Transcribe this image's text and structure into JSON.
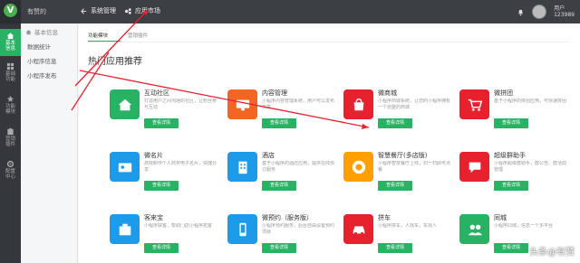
{
  "topbar": {
    "brand": "有赞的",
    "menu_system": "系统管理",
    "menu_market": "应用市场",
    "user": "用户\n123989"
  },
  "rail": [
    {
      "label": "基本\n信息",
      "icon": "home-icon",
      "active": true
    },
    {
      "label": "基础\n功能",
      "icon": "grid-icon",
      "active": false
    },
    {
      "label": "功能\n模块",
      "icon": "star-icon",
      "active": false
    },
    {
      "label": "营销\n插件",
      "icon": "puzzle-icon",
      "active": false
    },
    {
      "label": "配置\n中心",
      "icon": "gear-icon",
      "active": false
    }
  ],
  "subside": {
    "head": "基本信息",
    "items": [
      "数据统计",
      "小程序信息",
      "小程序发布"
    ]
  },
  "main": {
    "tabs": [
      "功能模块",
      "营销插件"
    ],
    "section_title": "热门应用推荐",
    "cards": [
      {
        "title": "互动社区",
        "desc": "打造用户之间沟通的社区，让粉丝参与互动",
        "btn": "查看详情",
        "color": "#27b264",
        "icon": "home-icon"
      },
      {
        "title": "内容管理",
        "desc": "小程序内容管理系统，用户可以发布文章",
        "btn": "查看详情",
        "color": "#f26522",
        "icon": "monitor-icon"
      },
      {
        "title": "微商城",
        "desc": "小程序商城系统，让您的小程序拥有一个完整的商城",
        "btn": "查看详情",
        "color": "#e8212e",
        "icon": "bag-icon"
      },
      {
        "title": "微拼团",
        "desc": "基于小程序的拼团应用，可快速拼团",
        "btn": "查看详情",
        "color": "#e8212e",
        "icon": "cart-icon"
      },
      {
        "title": "微名片",
        "desc": "高效制作个人商务电子名片，快捷分享",
        "btn": "查看详情",
        "color": "#1e9be8",
        "icon": "card-icon"
      },
      {
        "title": "酒店",
        "desc": "基于小程序的酒店应用，提供在线预订服务",
        "btn": "查看详情",
        "color": "#1e9be8",
        "icon": "building-icon"
      },
      {
        "title": "智慧餐厅(多店版)",
        "desc": "小程序智慧餐厅上线，扫一扫即可点餐",
        "btn": "查看详情",
        "color": "#ffa000",
        "icon": "coffee-icon"
      },
      {
        "title": "超级群助手",
        "desc": "小程序超级群助手，群公告、群活动管理",
        "btn": "查看详情",
        "color": "#e8212e",
        "icon": "chat-icon"
      },
      {
        "title": "客来宝",
        "desc": "小程序获客，帮助门店小程序拓客",
        "btn": "查看详情",
        "color": "#1e9be8",
        "icon": "box-icon"
      },
      {
        "title": "微预约（服务版）",
        "desc": "小程序预约服务，后台自由设置预约项目",
        "btn": "查看详情",
        "color": "#1e9be8",
        "icon": "phone-icon"
      },
      {
        "title": "拼车",
        "desc": "小程序拼车，人找车，车找人",
        "btn": "查看详情",
        "color": "#e8212e",
        "icon": "car-icon"
      },
      {
        "title": "同城",
        "desc": "小程序同城，信息一个多平台",
        "btn": "查看详情",
        "color": "#27b264",
        "icon": "people-icon"
      }
    ]
  },
  "watermark": "头条@有赞"
}
